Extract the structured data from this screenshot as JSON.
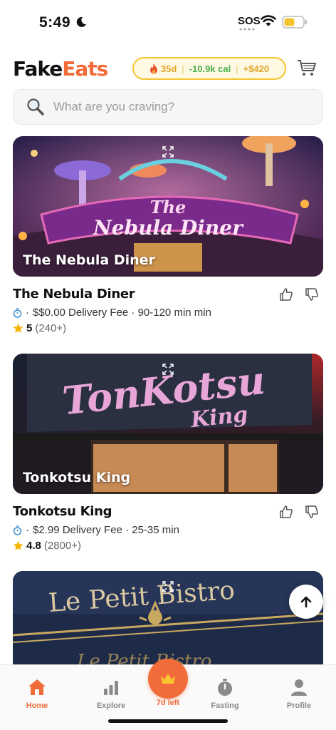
{
  "status_bar": {
    "time": "5:49",
    "carrier": "SOS"
  },
  "header": {
    "logo_part1": "Fake",
    "logo_part2": "Eats",
    "streak_days": "35d",
    "calories": "-10.9k cal",
    "money": "+$420"
  },
  "search": {
    "placeholder": "What are you craving?"
  },
  "restaurants": [
    {
      "name": "The Nebula Diner",
      "image_caption": "The Nebula Diner",
      "sign_text": "The Nebula Diner",
      "delivery": "$$0.00 Delivery Fee · 90-120 min min",
      "rating": "5",
      "reviews": "(240+)"
    },
    {
      "name": "Tonkotsu King",
      "image_caption": "Tonkotsu King",
      "sign_text": "TonKotsu King",
      "delivery": "$2.99 Delivery Fee · 25-35 min",
      "rating": "4.8",
      "reviews": "(2800+)"
    },
    {
      "name": "",
      "image_caption": "",
      "sign_text": "Le Petit Bistro",
      "delivery": "",
      "rating": "",
      "reviews": ""
    }
  ],
  "bottom_nav": {
    "home": "Home",
    "explore": "Explore",
    "center": "7d left",
    "fasting": "Fasting",
    "profile": "Profile"
  },
  "colors": {
    "brand": "#f26b3a",
    "streak_border": "#f4c430",
    "calorie_green": "#4caf50",
    "star": "#f5b301"
  },
  "icons": [
    "moon-icon",
    "wifi-icon",
    "battery-icon",
    "fire-icon",
    "cart-icon",
    "search-icon",
    "expand-icon",
    "timer-icon",
    "star-icon",
    "thumbs-up-icon",
    "thumbs-down-icon",
    "arrow-up-icon",
    "home-icon",
    "explore-icon",
    "crown-icon",
    "fasting-icon",
    "profile-icon"
  ]
}
